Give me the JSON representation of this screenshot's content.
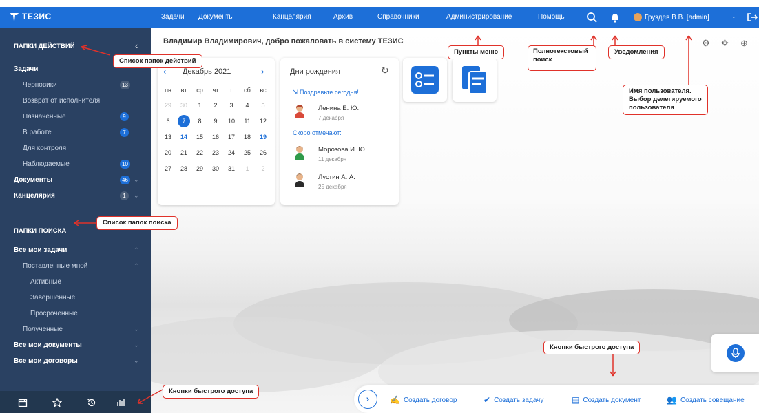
{
  "topbar": {
    "brand": "ТЕЗИС",
    "menu": [
      "Задачи",
      "Документы",
      "Канцелярия",
      "Архив",
      "Справочники",
      "Администрирование",
      "Помощь"
    ],
    "user": "Груздев В.В. [admin]"
  },
  "sidebar": {
    "actions_title": "ПАПКИ ДЕЙСТВИЙ",
    "tasks": "Задачи",
    "task_items": [
      {
        "label": "Черновики",
        "count": "13"
      },
      {
        "label": "Возврат от исполнителя",
        "count": ""
      },
      {
        "label": "Назначенные",
        "count": "9"
      },
      {
        "label": "В работе",
        "count": "7"
      },
      {
        "label": "Для контроля",
        "count": ""
      },
      {
        "label": "Наблюдаемые",
        "count": "10"
      }
    ],
    "documents": "Документы",
    "documents_count": "46",
    "office": "Канцелярия",
    "office_count": "1",
    "search_title": "ПАПКИ ПОИСКА",
    "all_tasks": "Все мои задачи",
    "created_by_me": "Поставленные мной",
    "active": "Активные",
    "done": "Завершённые",
    "overdue": "Просроченные",
    "received": "Полученные",
    "all_docs": "Все мои документы",
    "all_contracts": "Все мои договоры"
  },
  "main": {
    "welcome": "Владимир Владимирович, добро пожаловать в систему ТЕЗИС",
    "calendar": {
      "month": "Декабрь 2021",
      "weekdays": [
        "пн",
        "вт",
        "ср",
        "чт",
        "пт",
        "сб",
        "вс"
      ],
      "rows": [
        [
          "29",
          "30",
          "1",
          "2",
          "3",
          "4",
          "5"
        ],
        [
          "6",
          "7",
          "8",
          "9",
          "10",
          "11",
          "12"
        ],
        [
          "13",
          "14",
          "15",
          "16",
          "17",
          "18",
          "19"
        ],
        [
          "20",
          "21",
          "22",
          "23",
          "24",
          "25",
          "26"
        ],
        [
          "27",
          "28",
          "29",
          "30",
          "31",
          "1",
          "2"
        ]
      ]
    },
    "birthdays": {
      "title": "Дни рождения",
      "today_label": "Поздравьте сегодня!",
      "p1_name": "Ленина Е. Ю.",
      "p1_date": "7 декабря",
      "soon_label": "Скоро отмечают:",
      "p2_name": "Морозова И. Ю.",
      "p2_date": "11 декабря",
      "p3_name": "Лустин А. А.",
      "p3_date": "25 декабря"
    },
    "quick": [
      "Создать договор",
      "Создать задачу",
      "Создать документ",
      "Создать совещание"
    ]
  },
  "callouts": {
    "actions_list": "Список папок действий",
    "search_list": "Список папок поиска",
    "quick_left": "Кнопки быстрого доступа",
    "menu_items": "Пункты меню",
    "fulltext1": "Полнотекстовый",
    "fulltext2": "поиск",
    "notifications": "Уведомления",
    "username1": "Имя пользователя.",
    "username2": "Выбор делегируемого",
    "username3": "пользователя",
    "quick_right": "Кнопки быстрого доступа"
  },
  "colors": {
    "brand": "#1d6fd8",
    "sidebar": "#2a4162",
    "callout_border": "#e0322a"
  }
}
